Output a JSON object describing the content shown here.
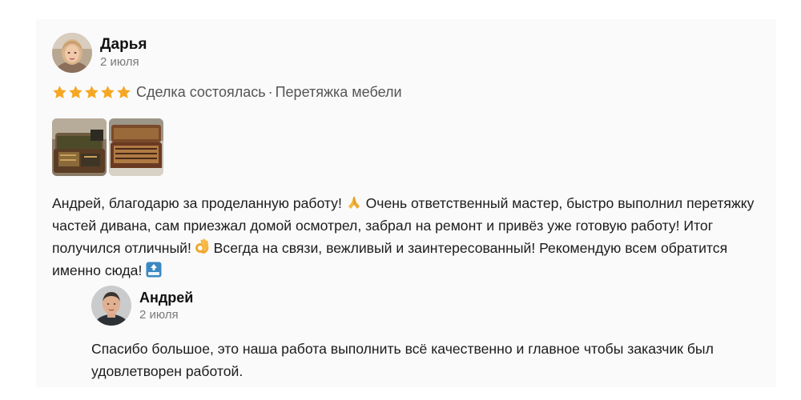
{
  "review": {
    "author_name": "Дарья",
    "date": "2 июля",
    "rating": 5,
    "deal_status": "Сделка состоялась",
    "separator": "·",
    "service": "Перетяжка мебели",
    "star_color": "#f5a623",
    "text_part1": "Андрей, благодарю за проделанную работу!",
    "text_part2": " Очень ответственный мастер, быстро выполнил перетяжку частей дивана, сам приезжал домой осмотрел, забрал на ремонт и привёз уже готовую работу! Итог получился отличный!",
    "text_part3": " Всегда на связи, вежливый и заинтересованный! Рекомендую всем обратится именно сюда!",
    "emoji_1": "folded-hands-emoji",
    "emoji_2": "ok-hand-emoji",
    "emoji_3": "top-arrow-emoji",
    "photos": [
      "sofa-photo-1",
      "sofa-photo-2"
    ]
  },
  "reply": {
    "author_name": "Андрей",
    "date": "2 июля",
    "text": "Спасибо большое, это наша работа выполнить всё качественно и главное чтобы заказчик был удовлетворен работой."
  }
}
